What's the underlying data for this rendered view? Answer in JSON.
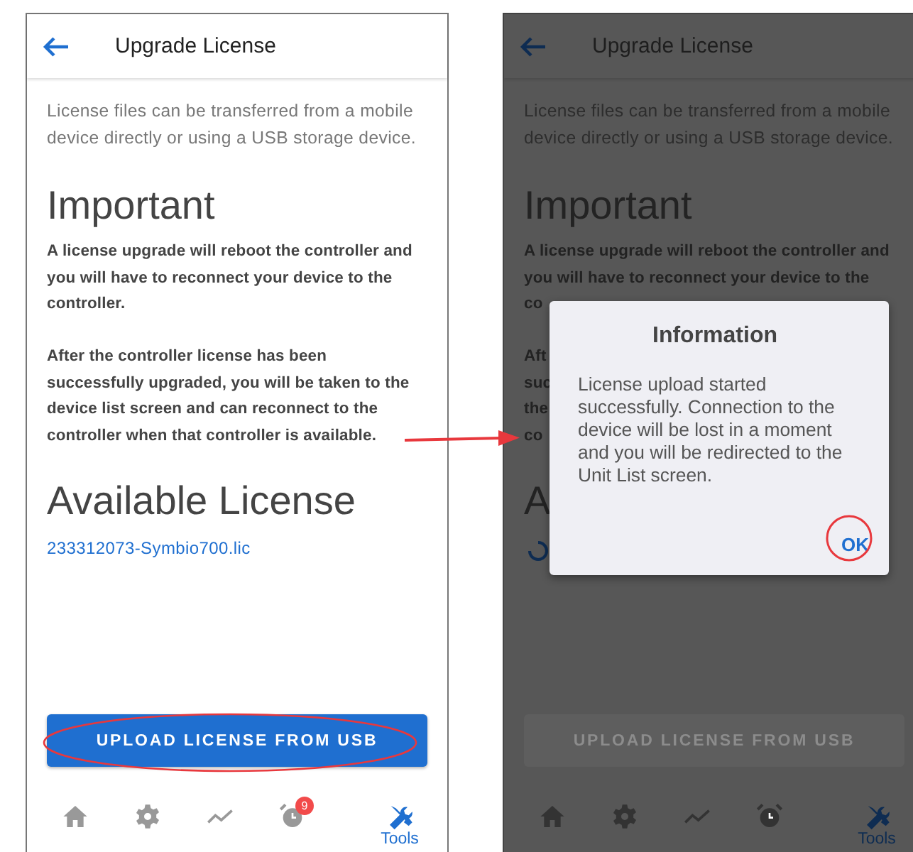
{
  "screens": [
    {
      "dimmed": false,
      "header": {
        "title": "Upgrade License"
      },
      "blocks": [
        {
          "kind": "intro",
          "text": "License files can be transferred from a mobile device directly or using a USB storage device."
        },
        {
          "kind": "heading",
          "text": "Important"
        },
        {
          "kind": "note",
          "text": "A license upgrade will reboot the controller and you will have to reconnect your device to the controller."
        },
        {
          "kind": "note",
          "text": "After the controller license has been successfully upgraded, you will be taken to the device list screen and can reconnect to the controller when that controller is available."
        },
        {
          "kind": "heading",
          "text": "Available License"
        },
        {
          "kind": "link",
          "text": "233312073-Symbio700.lic"
        }
      ],
      "button": {
        "label": "UPLOAD LICENSE FROM USB",
        "disabled": false
      },
      "nav": [
        {
          "kind": "home",
          "selected": false
        },
        {
          "kind": "gear",
          "selected": false
        },
        {
          "kind": "chart",
          "selected": false
        },
        {
          "kind": "alarm",
          "selected": false,
          "badge": "9"
        },
        {
          "kind": "tools",
          "label": "Tools",
          "selected": true
        }
      ]
    },
    {
      "dimmed": true,
      "header": {
        "title": "Upgrade License"
      },
      "blocks": [
        {
          "kind": "intro",
          "text": "License files can be transferred from a mobile device directly or using a USB storage device."
        },
        {
          "kind": "heading",
          "text": "Important"
        },
        {
          "kind": "note_lines",
          "lines": [
            "A license upgrade will reboot the controller and",
            "you will have to reconnect your device to the",
            "co"
          ]
        },
        {
          "kind": "note_lines",
          "lines": [
            "Aft",
            "suc",
            "the",
            "co"
          ]
        },
        {
          "kind": "heading",
          "text": "A"
        },
        {
          "kind": "spinner"
        }
      ],
      "button": {
        "label": "UPLOAD LICENSE FROM USB",
        "disabled": true
      },
      "nav": [
        {
          "kind": "home",
          "selected": false
        },
        {
          "kind": "gear",
          "selected": false
        },
        {
          "kind": "chart",
          "selected": false
        },
        {
          "kind": "alarm",
          "selected": false
        },
        {
          "kind": "tools",
          "label": "Tools",
          "selected": true
        }
      ],
      "dialog": {
        "title": "Information",
        "message": "License upload started successfully. Connection to the device will be lost in a moment and you will be redirected to the Unit List screen.",
        "button": "OK"
      }
    }
  ]
}
